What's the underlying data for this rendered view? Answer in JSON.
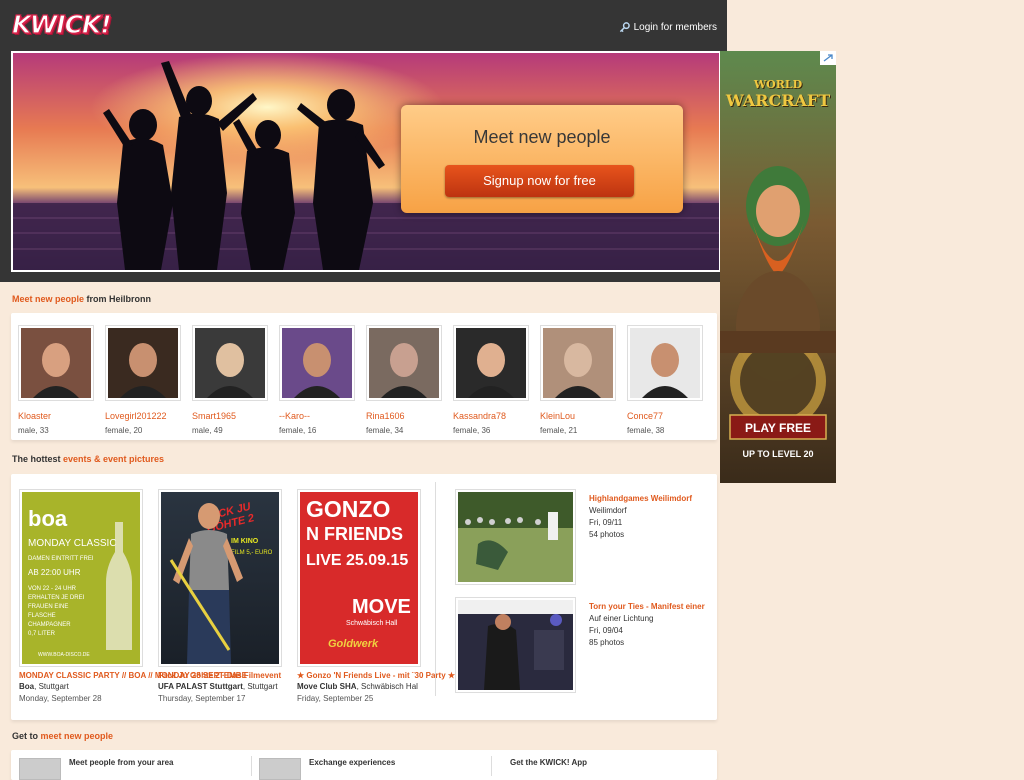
{
  "header": {
    "logo_text": "KWICK!",
    "login_label": "Login for members"
  },
  "hero": {
    "title": "Meet new people",
    "signup_label": "Signup now for free"
  },
  "ad": {
    "brand_line1": "WORLD",
    "brand_line2": "WARCRAFT",
    "cta": "PLAY FREE",
    "subtitle": "UP TO LEVEL 20"
  },
  "meet_section": {
    "title_highlight": "Meet new people",
    "title_rest": " from Heilbronn",
    "people": [
      {
        "name": "Kloaster",
        "info": "male, 33"
      },
      {
        "name": "Lovegirl201222",
        "info": "female, 20"
      },
      {
        "name": "Smart1965",
        "info": "male, 49"
      },
      {
        "name": "--Karo--",
        "info": "female, 16"
      },
      {
        "name": "Rina1606",
        "info": "female, 34"
      },
      {
        "name": "Kassandra78",
        "info": "female, 36"
      },
      {
        "name": "KleinLou",
        "info": "female, 21"
      },
      {
        "name": "Conce77",
        "info": "female, 38"
      }
    ]
  },
  "events_section": {
    "title_prefix": "The hottest ",
    "title_highlight": "events & event pictures",
    "events": [
      {
        "title": "MONDAY CLASSIC PARTY // BOA // MONDAY 28 SEPTEMBE",
        "venue_bold": "Boa",
        "venue_rest": ", Stuttgart",
        "date": "Monday, September 28",
        "poster": {
          "line1": "boa",
          "line2": "MONDAY CLASSIC",
          "line3": "DAMEN EINTRITT FREI",
          "line4": "AB 22:00 UHR",
          "line5": "VON 22 - 24 UHR",
          "line6": "ERHALTEN JE DREI",
          "line7": "FRAUEN EINE",
          "line8": "FLASCHE",
          "line9": "CHAMPAGNER",
          "line10": "0,7 LITER",
          "footer": "WWW.BOA-DISCO.DE"
        }
      },
      {
        "title": "Fack Ju Göhte 2 · Das Filmevent",
        "venue_bold": "UFA PALAST Stuttgart",
        "venue_rest": ", Stuttgart",
        "date": "Thursday, September 17",
        "poster": {
          "line1": "FUCK JU",
          "line2": "GÖHTE 2",
          "line3": "IM KINO",
          "line4": "FILM 5,- EURO"
        }
      },
      {
        "title": "★ Gonzo 'N Friends Live - mit ¨30 Party ★",
        "venue_bold": "Move Club SHA",
        "venue_rest": ", Schwäbisch Hal",
        "date": "Friday, September 25",
        "poster": {
          "line1": "GONZO",
          "line2": "N FRIENDS",
          "line3": "LIVE 25.09.15",
          "line4": "MOVE",
          "line5": "Schwäbisch Hall",
          "line6": "Goldwerk"
        }
      }
    ],
    "picture_events": [
      {
        "title": "Highlandgames Weilimdorf",
        "place": "Weilimdorf",
        "date": "Fri, 09/11",
        "photos": "54 photos"
      },
      {
        "title": "Torn your Ties - Manifest einer",
        "place": "Auf einer Lichtung",
        "date": "Fri, 09/04",
        "photos": "85 photos"
      }
    ]
  },
  "get_section": {
    "title_prefix": "Get to ",
    "title_highlight": "meet new people",
    "items": [
      {
        "label": "Meet people from your area"
      },
      {
        "label": "Exchange experiences"
      },
      {
        "label": "Get the KWICK! App"
      }
    ]
  }
}
